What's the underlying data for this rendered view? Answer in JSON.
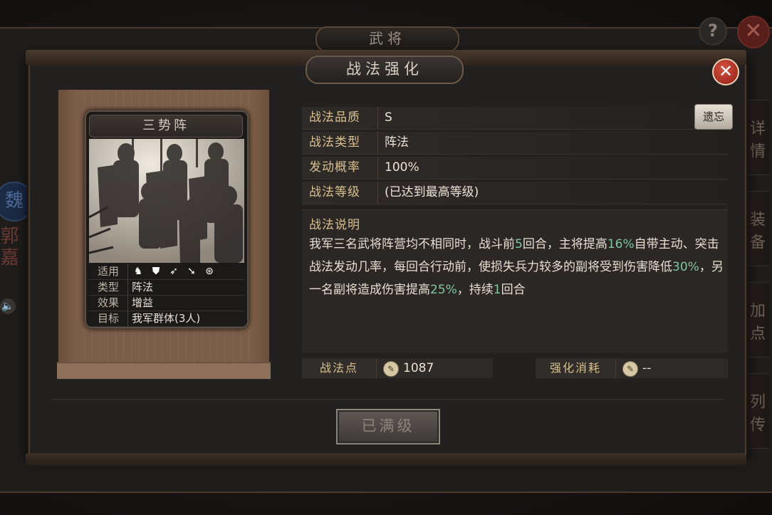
{
  "outer": {
    "title": "武将",
    "help_label": "?",
    "close_label": "✕"
  },
  "left_side": {
    "kingdom": "魏",
    "hero_name": "郭嘉",
    "speaker_icon": "speaker-icon"
  },
  "side_tabs": [
    "详情",
    "装备",
    "加点",
    "列传"
  ],
  "dialog": {
    "title": "战法强化",
    "close_label": "✕"
  },
  "card": {
    "name": "三势阵",
    "rows": [
      {
        "key": "适用",
        "value": ""
      },
      {
        "key": "类型",
        "value": "阵法"
      },
      {
        "key": "效果",
        "value": "增益"
      },
      {
        "key": "目标",
        "value": "我军群体(3人)"
      }
    ],
    "unit_icons": [
      "cavalry-icon",
      "shield-icon",
      "bow-icon",
      "spear-icon",
      "siege-icon"
    ]
  },
  "info": {
    "quality": {
      "label": "战法品质",
      "value": "S"
    },
    "type": {
      "label": "战法类型",
      "value": "阵法"
    },
    "rate": {
      "label": "发动概率",
      "value": "100%"
    },
    "level": {
      "label": "战法等级",
      "value": "(已达到最高等级)"
    },
    "legacy_button": "遗忘"
  },
  "description": {
    "title": "战法说明",
    "segments": [
      {
        "text": "我军三名武将阵营均不相同时，战斗前",
        "hl": false
      },
      {
        "text": "5",
        "hl": true
      },
      {
        "text": "回合，主将提高",
        "hl": false
      },
      {
        "text": "16%",
        "hl": true
      },
      {
        "text": "自带主动、突击战法发动几率，每回合行动前，使损失兵力较多的副将受到伤害降低",
        "hl": false
      },
      {
        "text": "30%",
        "hl": true
      },
      {
        "text": "，另一名副将造成伤害提高",
        "hl": false
      },
      {
        "text": "25%",
        "hl": true
      },
      {
        "text": "，持续",
        "hl": false
      },
      {
        "text": "1",
        "hl": true
      },
      {
        "text": "回合",
        "hl": false
      }
    ]
  },
  "points": {
    "label": "战法点",
    "value": "1087",
    "cost_label": "强化消耗",
    "cost_value": "--"
  },
  "max_button": "已满级"
}
